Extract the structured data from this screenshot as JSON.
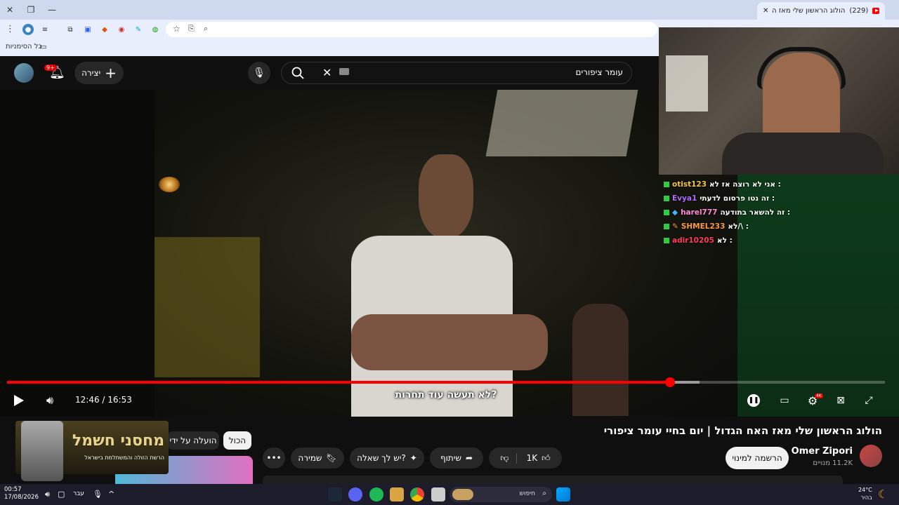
{
  "browser": {
    "tab_title": "הולוג הראשון שלי מאז האח...",
    "tab_count": "(229)",
    "bookmarks_label": "כל הסימניות"
  },
  "youtube": {
    "create_label": "יצירה",
    "notifications_badge": "9+",
    "search_value": "עומר ציפורים"
  },
  "chat": [
    {
      "user": "otist123",
      "msg": "אני לא רוצה אז לא :",
      "color": "#f5c542"
    },
    {
      "user": "Evya1",
      "msg": "זה נטו פרסום לדעתי :",
      "color": "#b36bff"
    },
    {
      "user": "harel777",
      "msg": "זה להשאר בתודעה :",
      "color": "#ff8ad8"
    },
    {
      "user": "SHMEL233",
      "msg": "לא/\\ :",
      "color": "#ff9a3c"
    },
    {
      "user": "adir10205",
      "msg": "לא :",
      "color": "#ff3b5c"
    }
  ],
  "player": {
    "time": "12:46 / 16:53",
    "progress": 0.755,
    "buffered": 0.789,
    "caption": "לא תעשה עוד תחרות?"
  },
  "video": {
    "title": "הולוג הראשון שלי מאז האח הגדול | יום בחיי עומר ציפורי",
    "channel": "Omer Zipori",
    "subscribers": "11.2K מנויים",
    "subscribe_label": "הרשמה למינוי",
    "like_count": "1K",
    "share_label": "שיתוף",
    "ask_label": "יש לך שאלה?",
    "save_label": "שמירה"
  },
  "filters": {
    "all": "הכול",
    "uploaded_by": "הועלה על ידי"
  },
  "ad": {
    "title": "מחסני חשמל",
    "subtitle": "הרשת הזולה והמשתלמת בישראל"
  },
  "taskbar": {
    "time": "00:57",
    "date": "17/08/2026",
    "lang": "עבר",
    "search_placeholder": "חיפוש",
    "weather_temp": "24°C",
    "weather_desc": "בהיר"
  }
}
